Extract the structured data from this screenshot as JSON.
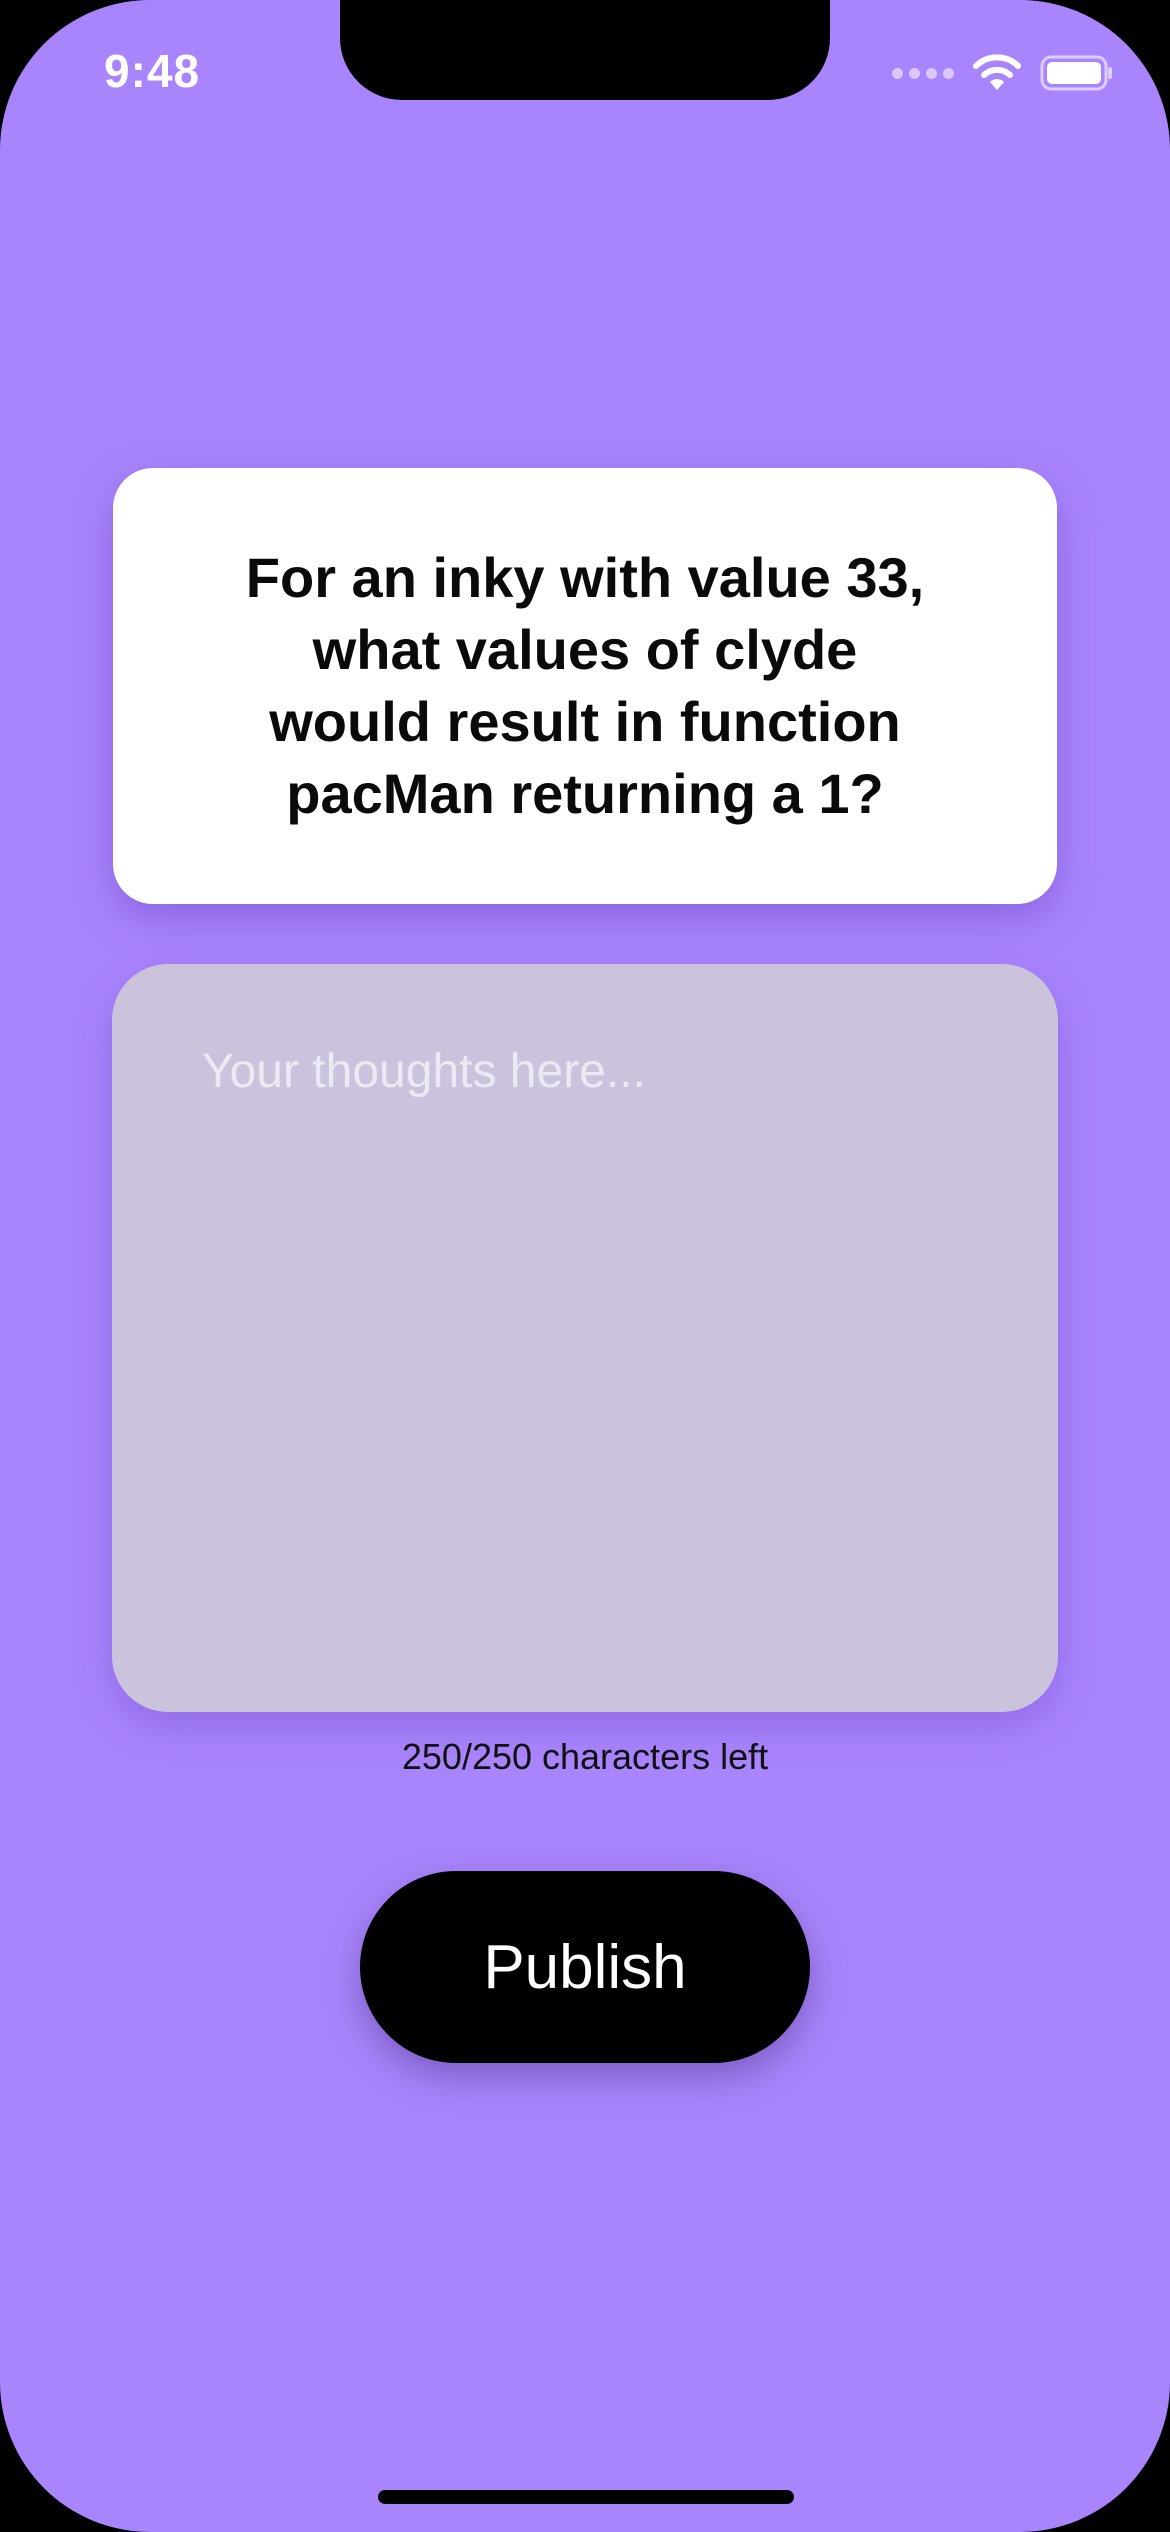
{
  "status_bar": {
    "time": "9:48",
    "icons": [
      "signal-icon",
      "wifi-icon",
      "battery-icon"
    ]
  },
  "question": {
    "text": "For an inky with value 33, what values of clyde would result in function pacMan returning a 1?"
  },
  "answer": {
    "value": "",
    "placeholder": "Your thoughts here..."
  },
  "counter": {
    "text": "250/250 characters left",
    "remaining": 250,
    "max": 250
  },
  "publish": {
    "label": "Publish"
  },
  "colors": {
    "background": "#a985fd",
    "card": "#ffffff",
    "input_box": "#cbc3dc",
    "button": "#000000",
    "button_text": "#ffffff"
  }
}
